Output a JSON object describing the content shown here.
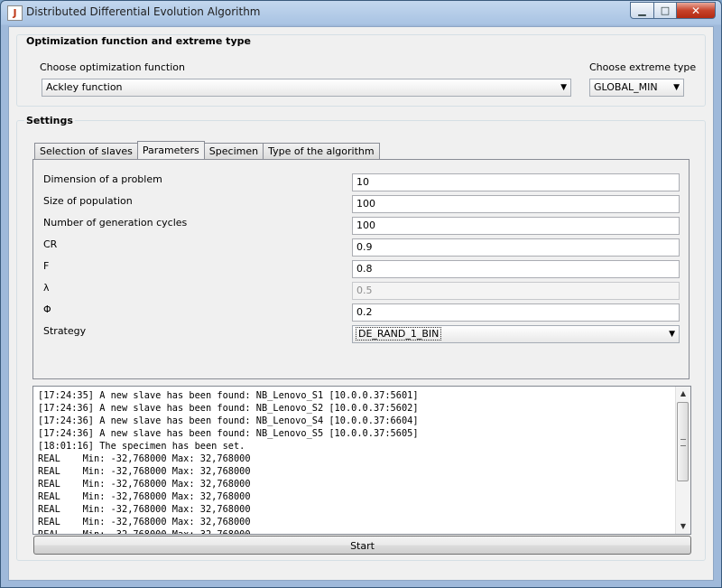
{
  "window": {
    "title": "Distributed Differential Evolution Algorithm",
    "minimize_glyph": "▁",
    "maximize_glyph": "□",
    "close_glyph": "✕"
  },
  "optimization": {
    "title": "Optimization function and extreme type",
    "function_label": "Choose optimization function",
    "function_value": "Ackley function",
    "extreme_label": "Choose extreme type",
    "extreme_value": "GLOBAL_MIN"
  },
  "settings": {
    "title": "Settings",
    "tabs": [
      {
        "label": "Selection of slaves",
        "active": false
      },
      {
        "label": "Parameters",
        "active": true
      },
      {
        "label": "Specimen",
        "active": false
      },
      {
        "label": "Type of the algorithm",
        "active": false
      }
    ],
    "params": [
      {
        "label": "Dimension of a problem",
        "value": "10",
        "enabled": true
      },
      {
        "label": "Size of population",
        "value": "100",
        "enabled": true
      },
      {
        "label": "Number of generation cycles",
        "value": "100",
        "enabled": true
      },
      {
        "label": "CR",
        "value": "0.9",
        "enabled": true
      },
      {
        "label": "F",
        "value": "0.8",
        "enabled": true
      },
      {
        "label": "λ",
        "value": "0.5",
        "enabled": false
      },
      {
        "label": "Φ",
        "value": "0.2",
        "enabled": true
      }
    ],
    "strategy_label": "Strategy",
    "strategy_value": "DE_RAND_1_BIN"
  },
  "log": {
    "lines": [
      "[17:24:35] A new slave has been found: NB_Lenovo_S1 [10.0.0.37:5601]",
      "[17:24:36] A new slave has been found: NB_Lenovo_S2 [10.0.0.37:5602]",
      "[17:24:36] A new slave has been found: NB_Lenovo_S4 [10.0.0.37:6604]",
      "[17:24:36] A new slave has been found: NB_Lenovo_S5 [10.0.0.37:5605]",
      "[18:01:16] The specimen has been set.",
      "REAL    Min: -32,768000 Max: 32,768000",
      "REAL    Min: -32,768000 Max: 32,768000",
      "REAL    Min: -32,768000 Max: 32,768000",
      "REAL    Min: -32,768000 Max: 32,768000",
      "REAL    Min: -32,768000 Max: 32,768000",
      "REAL    Min: -32,768000 Max: 32,768000",
      "REAL    Min: -32,768000 Max: 32,768000"
    ]
  },
  "start_label": "Start",
  "icons": {
    "dropdown": "▼",
    "scroll_up": "▲",
    "scroll_down": "▼"
  }
}
